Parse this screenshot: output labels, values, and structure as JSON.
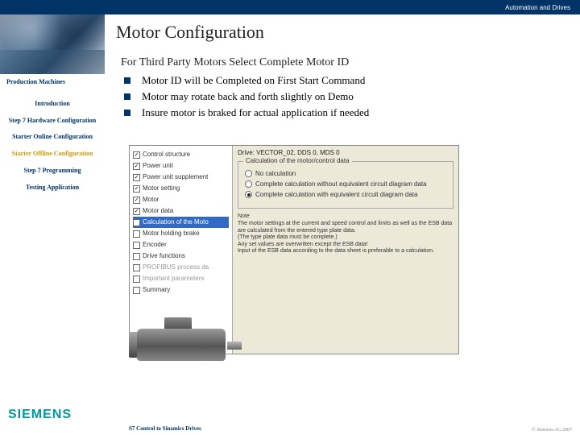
{
  "topbar": {
    "label": "Automation and Drives"
  },
  "header": {
    "title": "Motor Configuration"
  },
  "sidebar": {
    "app": "Production Machines",
    "items": [
      {
        "label": "Introduction",
        "active": false
      },
      {
        "label": "Step 7 Hardware Configuration",
        "active": false
      },
      {
        "label": "Starter Online Configuration",
        "active": false
      },
      {
        "label": "Starter Offline Configuration",
        "active": true
      },
      {
        "label": "Step 7 Programming",
        "active": false
      },
      {
        "label": "Testing Application",
        "active": false
      }
    ]
  },
  "content": {
    "subtitle": "For Third Party Motors Select Complete Motor ID",
    "bullets": [
      "Motor ID will be Completed on First Start Command",
      "Motor may rotate back and forth slightly on Demo",
      "Insure motor is braked for actual application if needed"
    ]
  },
  "dialog": {
    "drive_label": "Drive: VECTOR_02, DDS 0, MDS 0",
    "left_items": [
      {
        "label": "Control structure",
        "checked": true
      },
      {
        "label": "Power unit",
        "checked": true
      },
      {
        "label": "Power unit supplement",
        "checked": true
      },
      {
        "label": "Motor setting",
        "checked": true
      },
      {
        "label": "Motor",
        "checked": true
      },
      {
        "label": "Motor data",
        "checked": true
      },
      {
        "label": "Calculation of the Moto",
        "checked": false,
        "highlighted": true
      },
      {
        "label": "Motor holding brake",
        "checked": false
      },
      {
        "label": "Encoder",
        "checked": false
      },
      {
        "label": "Drive functions",
        "checked": false
      },
      {
        "label": "PROFIBUS process da",
        "checked": false,
        "disabled": true
      },
      {
        "label": "Important parameters",
        "checked": false,
        "disabled": true
      },
      {
        "label": "Summary",
        "checked": false
      }
    ],
    "group_legend": "Calculation of the motor/control data",
    "radios": [
      {
        "label": "No calculation",
        "selected": false
      },
      {
        "label": "Complete calculation without equivalent circuit diagram data",
        "selected": false
      },
      {
        "label": "Complete calculation with equivalent circuit diagram data",
        "selected": true
      }
    ],
    "note_head": "Note",
    "note_lines": [
      "The motor settings at the current and speed control and limits as well as the ESB data are calculated from the entered type plate data.",
      "(The type plate data must be complete.)",
      "Any set values are overwritten except the ESB data!",
      "Input of the ESB data according to the data sheet is preferable to a calculation."
    ]
  },
  "footer": {
    "logo": "SIEMENS",
    "text": "S7 Control to Sinamics Drives",
    "right": "© Siemens AG 2007"
  }
}
